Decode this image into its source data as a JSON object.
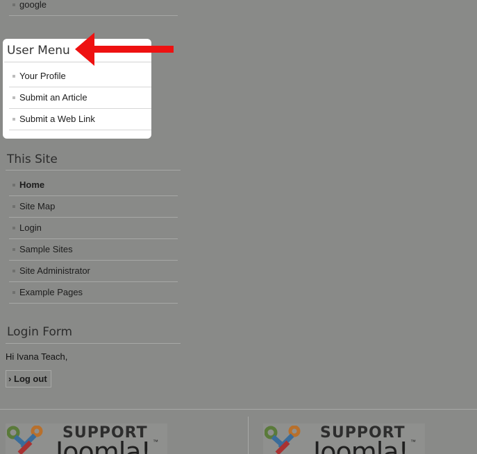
{
  "top_list": {
    "items": [
      {
        "label": "google"
      }
    ]
  },
  "user_menu": {
    "title": "User Menu",
    "items": [
      {
        "label": "Your Profile"
      },
      {
        "label": "Submit an Article"
      },
      {
        "label": "Submit a Web Link"
      }
    ]
  },
  "this_site": {
    "title": "This Site",
    "items": [
      {
        "label": "Home",
        "active": true
      },
      {
        "label": "Site Map"
      },
      {
        "label": "Login"
      },
      {
        "label": "Sample Sites"
      },
      {
        "label": "Site Administrator"
      },
      {
        "label": "Example Pages"
      }
    ]
  },
  "login_form": {
    "title": "Login Form",
    "greeting": "Hi Ivana Teach,",
    "logout_label": "Log out",
    "logout_icon": "chevron-right-icon"
  },
  "footer": {
    "banners": [
      {
        "word": "SUPPORT",
        "brand": "Joomla!",
        "tm": "™"
      },
      {
        "word": "SUPPORT",
        "brand": "Joomla!",
        "tm": "™"
      }
    ]
  },
  "annotation": {
    "arrow_color": "#ee1111",
    "icon": "arrow-left-icon"
  },
  "colors": {
    "background": "#898a88",
    "highlight": "#ffffff"
  }
}
